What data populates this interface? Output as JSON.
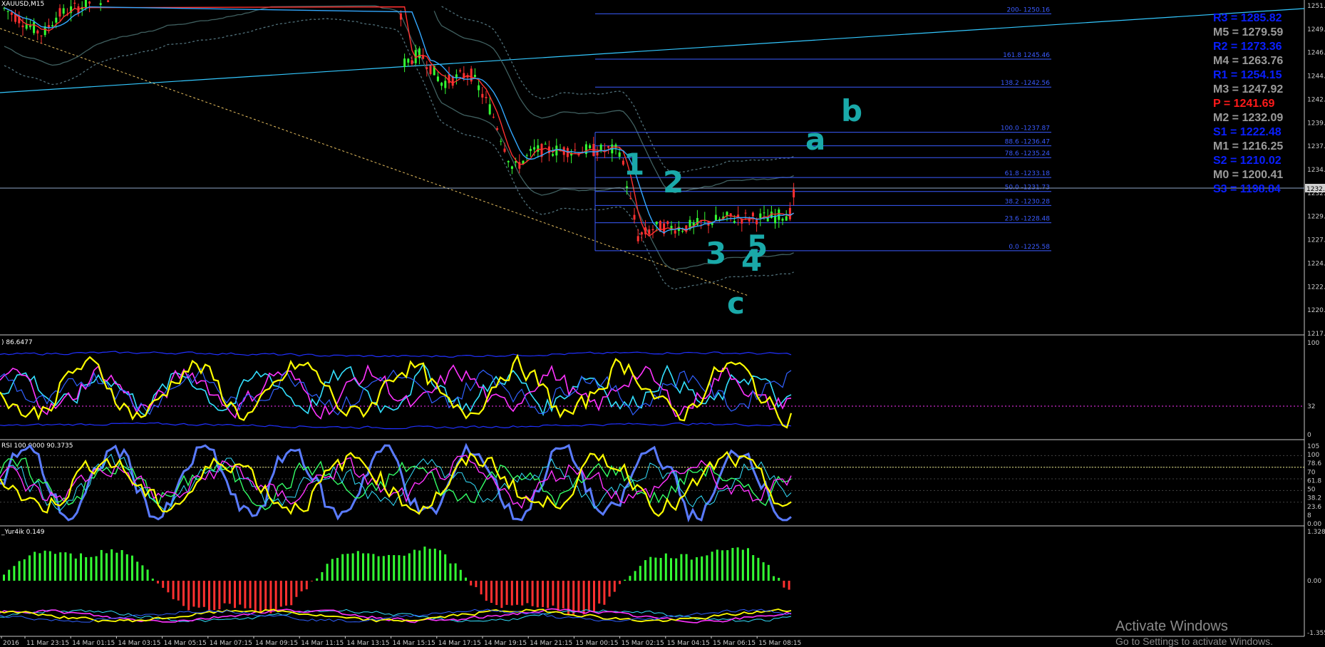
{
  "chart_data": [
    {
      "type": "candlestick",
      "symbol": "XAUUSD,M15",
      "ylim": [
        1217,
        1251
      ],
      "y_ticks": [
        "1251.",
        "1249.",
        "1246.",
        "1244.",
        "1242.",
        "1239.",
        "1237.",
        "1234.",
        "1232.",
        "1229.",
        "1227.",
        "1224.",
        "1222.",
        "1220.",
        "1217."
      ],
      "current_price_label": "1232.",
      "candles": [
        [
          1232.0,
          1239.0,
          1226.0,
          1238.0
        ],
        [
          1238.0,
          1240.0,
          1237.0,
          1238.5
        ],
        [
          1238.5,
          1239.5,
          1237.5,
          1238.8
        ]
      ],
      "fib_levels": [
        {
          "label": "200- 1250.16",
          "value": 1250.16
        },
        {
          "label": "161.8 1245.46",
          "value": 1245.46
        },
        {
          "label": "138.2 -1242.56",
          "value": 1242.56
        },
        {
          "label": "100.0 -1237.87",
          "value": 1237.87
        },
        {
          "label": "88.6 -1236.47",
          "value": 1236.47
        },
        {
          "label": "78.6 -1235.24",
          "value": 1235.24
        },
        {
          "label": "61.8 -1233.18",
          "value": 1233.18
        },
        {
          "label": "50.0 -1231.73",
          "value": 1231.73
        },
        {
          "label": "38.2 -1230.28",
          "value": 1230.28
        },
        {
          "label": "23.6 -1228.48",
          "value": 1228.48
        },
        {
          "label": "0.0 -1225.58",
          "value": 1225.58
        }
      ],
      "pivots": [
        {
          "label": "R3 = 1285.82",
          "color": "#0a1fff"
        },
        {
          "label": "M5 = 1279.59",
          "color": "#9a9a9a"
        },
        {
          "label": "R2 = 1273.36",
          "color": "#0a1fff"
        },
        {
          "label": "M4 = 1263.76",
          "color": "#9a9a9a"
        },
        {
          "label": "R1 = 1254.15",
          "color": "#0a1fff"
        },
        {
          "label": "M3 = 1247.92",
          "color": "#9a9a9a"
        },
        {
          "label": "P  = 1241.69",
          "color": "#ff1a1a"
        },
        {
          "label": "M2 = 1232.09",
          "color": "#9a9a9a"
        },
        {
          "label": "S1 = 1222.48",
          "color": "#0a1fff"
        },
        {
          "label": "M1 = 1216.25",
          "color": "#9a9a9a"
        },
        {
          "label": "S2 = 1210.02",
          "color": "#0a1fff"
        },
        {
          "label": "M0 = 1200.41",
          "color": "#9a9a9a"
        },
        {
          "label": "S3 = 1198.84",
          "color": "#0a1fff"
        }
      ],
      "wave_labels": [
        "1",
        "2",
        "3",
        "4",
        "5",
        "a",
        "b",
        "c"
      ]
    },
    {
      "type": "line",
      "label": ") 86.6477",
      "ylim": [
        0,
        100
      ],
      "y_ticks": [
        "100",
        "32",
        "0"
      ]
    },
    {
      "type": "line",
      "label": "RSI 100.0000 90.3735",
      "ylim": [
        0,
        105
      ],
      "y_ticks": [
        "105",
        "100",
        "78.6",
        "70",
        "61.8",
        "50",
        "38.2",
        "23.6",
        "8",
        "0.00"
      ]
    },
    {
      "type": "bar",
      "label": "_Yur4ik 0.149",
      "ylim": [
        -1.355,
        1.328
      ],
      "y_ticks": [
        "1.328",
        "0.00",
        "-1.355"
      ]
    }
  ],
  "x_ticks": [
    "2016",
    "11 Mar 23:15",
    "14 Mar 01:15",
    "14 Mar 03:15",
    "14 Mar 05:15",
    "14 Mar 07:15",
    "14 Mar 09:15",
    "14 Mar 11:15",
    "14 Mar 13:15",
    "14 Mar 15:15",
    "14 Mar 17:15",
    "14 Mar 19:15",
    "14 Mar 21:15",
    "15 Mar 00:15",
    "15 Mar 02:15",
    "15 Mar 04:15",
    "15 Mar 06:15",
    "15 Mar 08:15"
  ],
  "watermark": {
    "line1": "Activate Windows",
    "line2": "Go to Settings to activate Windows."
  },
  "colors": {
    "bull": "#33ff33",
    "bear": "#ff3030",
    "axis": "#c8c8c8",
    "fib": "#3a5bff",
    "wave": "#1aa9a9",
    "yellow": "#ffff00",
    "magenta": "#ff33ff",
    "cyan": "#33e0ff",
    "blueLine": "#4a6cff"
  }
}
